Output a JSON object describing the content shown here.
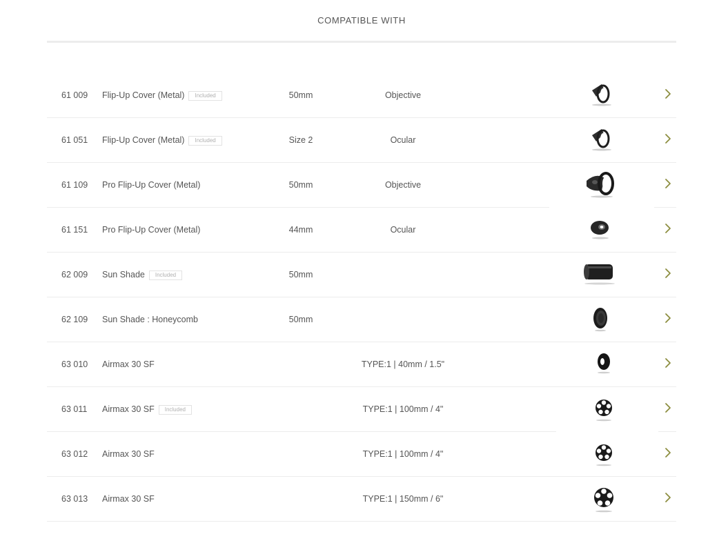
{
  "section": {
    "title": "COMPATIBLE WITH"
  },
  "colors": {
    "accent": "#8c8d3f",
    "divider": "#ececec",
    "text": "#555555",
    "badge_text": "#b0b0b0"
  },
  "products": [
    {
      "code": "61 009",
      "name": "Flip-Up Cover (Metal)",
      "badge": "Included",
      "size": "50mm",
      "position": "Objective",
      "icon": "flip-up-cover-image"
    },
    {
      "code": "61 051",
      "name": "Flip-Up Cover (Metal)",
      "badge": "Included",
      "size": "Size 2",
      "position": "Ocular",
      "icon": "flip-up-cover-image"
    },
    {
      "code": "61 109",
      "name": "Pro Flip-Up Cover (Metal)",
      "badge": "",
      "size": "50mm",
      "position": "Objective",
      "icon": "pro-flip-up-cover-image"
    },
    {
      "code": "61 151",
      "name": "Pro Flip-Up Cover (Metal)",
      "badge": "",
      "size": "44mm",
      "position": "Ocular",
      "icon": "pro-flip-up-cover-small-image"
    },
    {
      "code": "62 009",
      "name": "Sun Shade",
      "badge": "Included",
      "size": "50mm",
      "position": "",
      "icon": "sun-shade-image"
    },
    {
      "code": "62 109",
      "name": "Sun Shade : Honeycomb",
      "badge": "",
      "size": "50mm",
      "position": "",
      "icon": "honeycomb-image"
    },
    {
      "code": "63 010",
      "name": "Airmax 30 SF",
      "badge": "",
      "size": "",
      "position": "TYPE:1 | 40mm / 1.5\"",
      "icon": "airmax-wheel-solid-image"
    },
    {
      "code": "63 011",
      "name": "Airmax 30 SF",
      "badge": "Included",
      "size": "",
      "position": "TYPE:1 | 100mm / 4\"",
      "icon": "airmax-wheel-image"
    },
    {
      "code": "63 012",
      "name": "Airmax 30 SF",
      "badge": "",
      "size": "",
      "position": "TYPE:1 | 100mm / 4\"",
      "icon": "airmax-wheel-image"
    },
    {
      "code": "63 013",
      "name": "Airmax 30 SF",
      "badge": "",
      "size": "",
      "position": "TYPE:1 | 150mm / 6\"",
      "icon": "airmax-wheel-large-image"
    }
  ]
}
